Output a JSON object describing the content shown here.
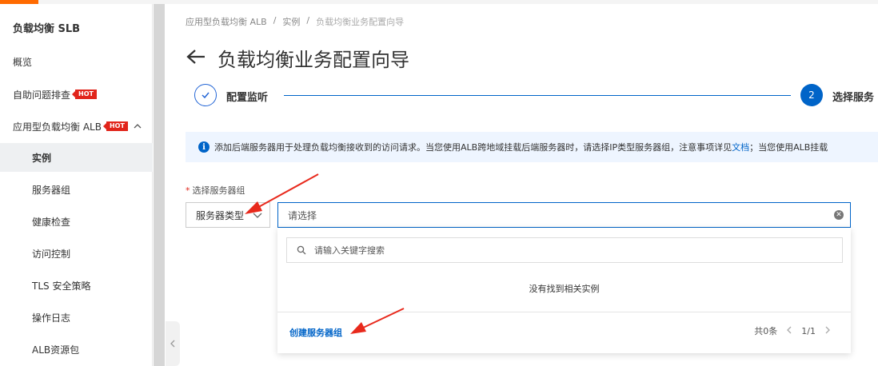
{
  "sidebar": {
    "title": "负载均衡 SLB",
    "items": [
      {
        "label": "概览"
      },
      {
        "label": "自助问题排查",
        "badge": "HOT"
      },
      {
        "label": "应用型负载均衡 ALB",
        "badge": "HOT"
      },
      {
        "label": "实例"
      },
      {
        "label": "服务器组"
      },
      {
        "label": "健康检查"
      },
      {
        "label": "访问控制"
      },
      {
        "label": "TLS 安全策略"
      },
      {
        "label": "操作日志"
      },
      {
        "label": "ALB资源包"
      }
    ]
  },
  "breadcrumb": {
    "items": [
      "应用型负载均衡 ALB",
      "实例",
      "负载均衡业务配置向导"
    ],
    "separator": "/"
  },
  "page": {
    "title": "负载均衡业务配置向导"
  },
  "steps": [
    {
      "label": "配置监听",
      "status": "done"
    },
    {
      "number": "2",
      "label": "选择服务",
      "status": "active"
    }
  ],
  "info": {
    "text_before": "添加后端服务器用于处理负载均衡接收到的访问请求。当您使用ALB跨地域挂载后端服务器时，请选择IP类型服务器组，注意事项详见",
    "link": "文档",
    "text_after": "；当您使用ALB挂载"
  },
  "form": {
    "label": "选择服务器组",
    "type_select": "服务器类型",
    "combo_placeholder": "请选择",
    "dropdown": {
      "search_placeholder": "请输入关键字搜索",
      "empty_text": "没有找到相关实例",
      "create_label": "创建服务器组",
      "total": "共0条",
      "page": "1/1"
    }
  },
  "colors": {
    "primary": "#0064c8",
    "hot": "#e1251b",
    "annotation": "#e8291c"
  }
}
